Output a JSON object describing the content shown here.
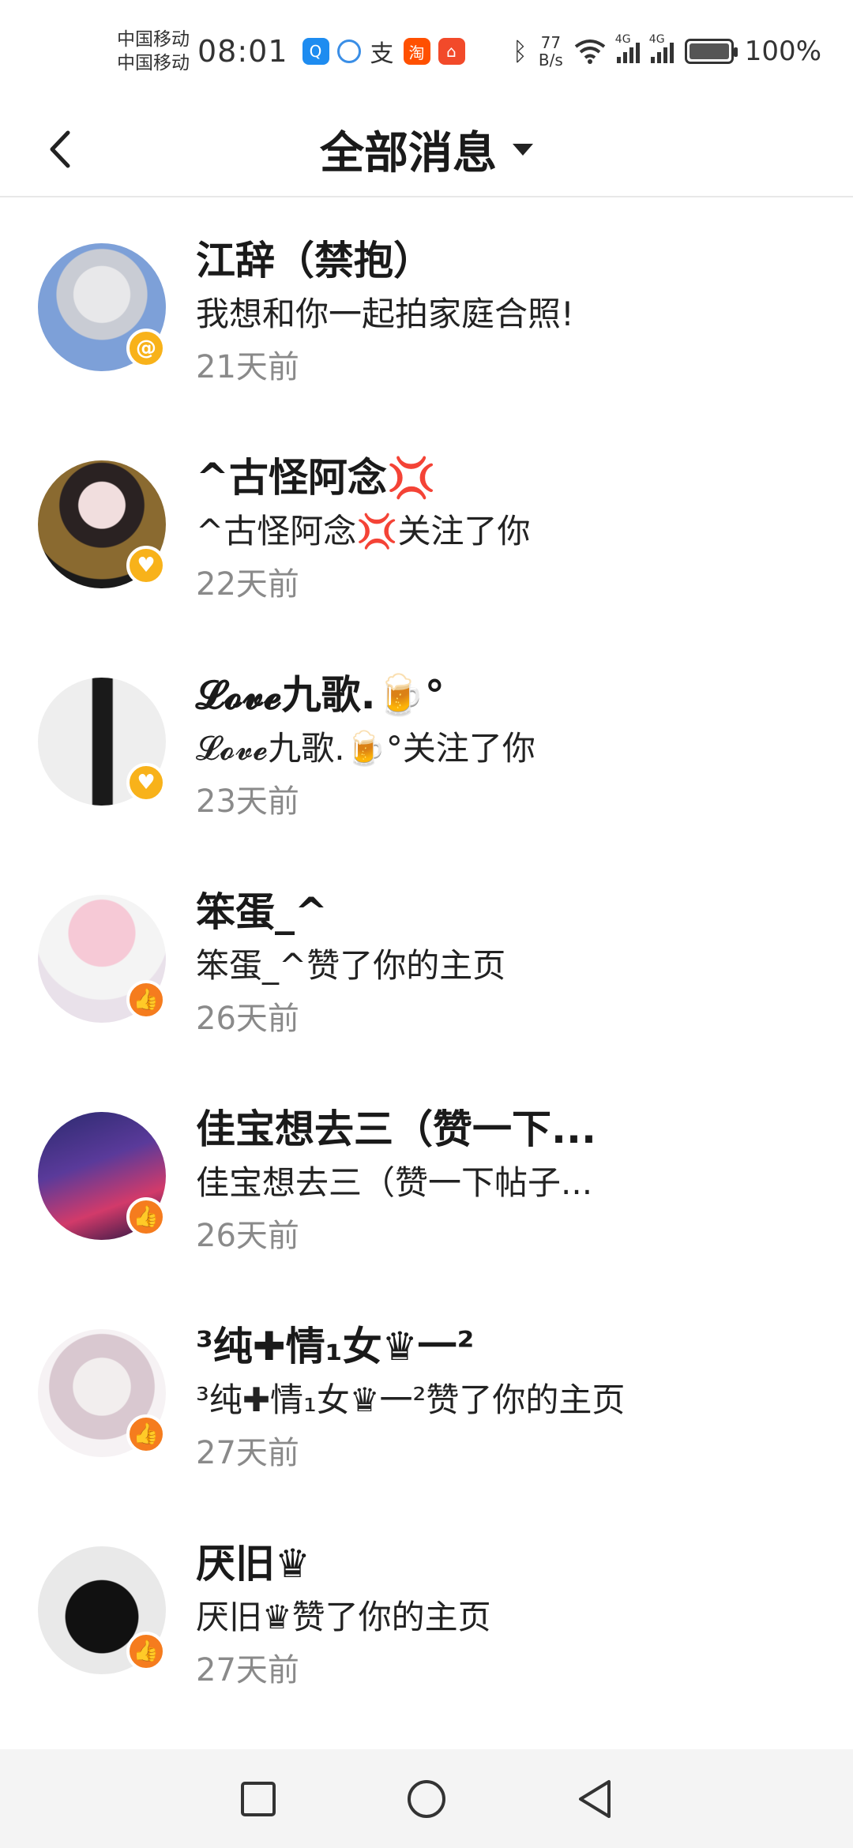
{
  "status_bar": {
    "carrier_1": "中国移动",
    "carrier_2": "中国移动",
    "time": "08:01",
    "net_speed_value": "77",
    "net_speed_unit": "B/s",
    "signal_label": "4G",
    "battery_percent": "100%"
  },
  "header": {
    "title": "全部消息"
  },
  "messages": [
    {
      "name": "江辞（禁抱）",
      "text": "我想和你一起拍家庭合照!",
      "time": "21天前",
      "badge": "@",
      "badge_type": "mention"
    },
    {
      "name": "^古怪阿念💢",
      "text": "^古怪阿念💢关注了你",
      "time": "22天前",
      "badge": "♥",
      "badge_type": "follow"
    },
    {
      "name": "𝓛𝓸𝓿𝓮九歌.🍺°",
      "text": "𝓛𝓸𝓿𝓮九歌.🍺°关注了你",
      "time": "23天前",
      "badge": "♥",
      "badge_type": "follow"
    },
    {
      "name": "笨蛋_^",
      "text": "笨蛋_^赞了你的主页",
      "time": "26天前",
      "badge": "👍",
      "badge_type": "like"
    },
    {
      "name": "佳宝想去三（赞一下...",
      "text": "佳宝想去三（赞一下帖子...",
      "time": "26天前",
      "badge": "👍",
      "badge_type": "like"
    },
    {
      "name": "³纯✚情₁女♛一²",
      "text": "³纯✚情₁女♛一²赞了你的主页",
      "time": "27天前",
      "badge": "👍",
      "badge_type": "like"
    },
    {
      "name": "厌旧♛",
      "text": "厌旧♛赞了你的主页",
      "time": "27天前",
      "badge": "👍",
      "badge_type": "like"
    }
  ],
  "colors": {
    "follow_badge": "#f8b21a",
    "like_badge": "#f57c1e",
    "time_text": "#8a8a8a"
  }
}
